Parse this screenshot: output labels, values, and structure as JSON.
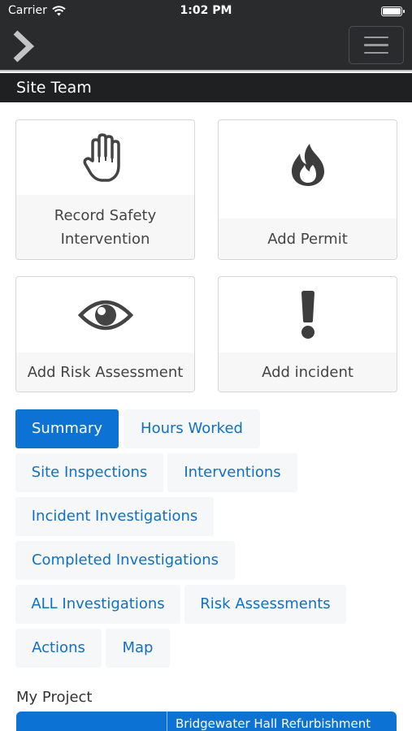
{
  "status_bar": {
    "carrier": "Carrier",
    "time": "1:02 PM"
  },
  "nav": {
    "back_icon": "chevron-right-icon",
    "menu_icon": "hamburger-icon"
  },
  "section": {
    "title": "Site Team"
  },
  "tiles": [
    {
      "label_line1": "Record Safety",
      "label_line2": "Intervention",
      "icon": "hand-icon"
    },
    {
      "label": "Add Permit",
      "icon": "fire-icon"
    },
    {
      "label": "Add Risk Assessment",
      "icon": "eye-icon"
    },
    {
      "label": "Add incident",
      "icon": "exclamation-icon"
    }
  ],
  "tabs": [
    {
      "label": "Summary",
      "active": true
    },
    {
      "label": "Hours Worked"
    },
    {
      "label": "Site Inspections"
    },
    {
      "label": "Interventions"
    },
    {
      "label": "Incident Investigations"
    },
    {
      "label": "Completed Investigations"
    },
    {
      "label": "ALL Investigations"
    },
    {
      "label": "Risk Assessments"
    },
    {
      "label": "Actions"
    },
    {
      "label": "Map"
    }
  ],
  "project": {
    "heading": "My Project",
    "name": "Bridgewater Hall Refurbishment"
  },
  "colors": {
    "accent": "#0c73d4",
    "bar": "#2a2b2d",
    "icon": "#444444"
  }
}
